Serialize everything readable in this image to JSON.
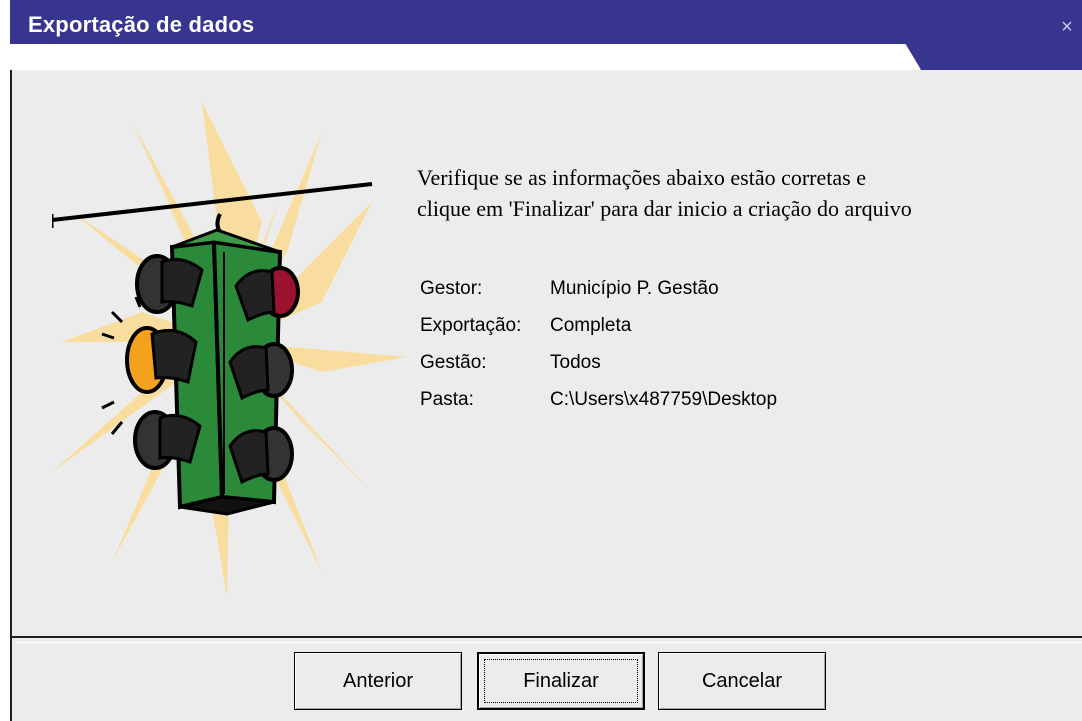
{
  "window": {
    "title": "Exportação de dados",
    "close_glyph": "×"
  },
  "message": {
    "line1": "Verifique se as informações abaixo estão corretas e",
    "line2": "clique em 'Finalizar' para dar inicio a criação do arquivo"
  },
  "info": [
    {
      "label": "Gestor:",
      "value": "Município P. Gestão"
    },
    {
      "label": "Exportação:",
      "value": "Completa"
    },
    {
      "label": "Gestão:",
      "value": "Todos"
    },
    {
      "label": "Pasta:",
      "value": "C:\\Users\\x487759\\Desktop"
    }
  ],
  "buttons": {
    "back": "Anterior",
    "finish": "Finalizar",
    "cancel": "Cancelar"
  },
  "colors": {
    "titlebar": "#37358f",
    "content_bg": "#ececec",
    "starburst": "#f9dd9e",
    "traffic_light": "#2a8a3a"
  },
  "icons": {
    "close": "close-icon",
    "illustration": "traffic-light-icon"
  }
}
